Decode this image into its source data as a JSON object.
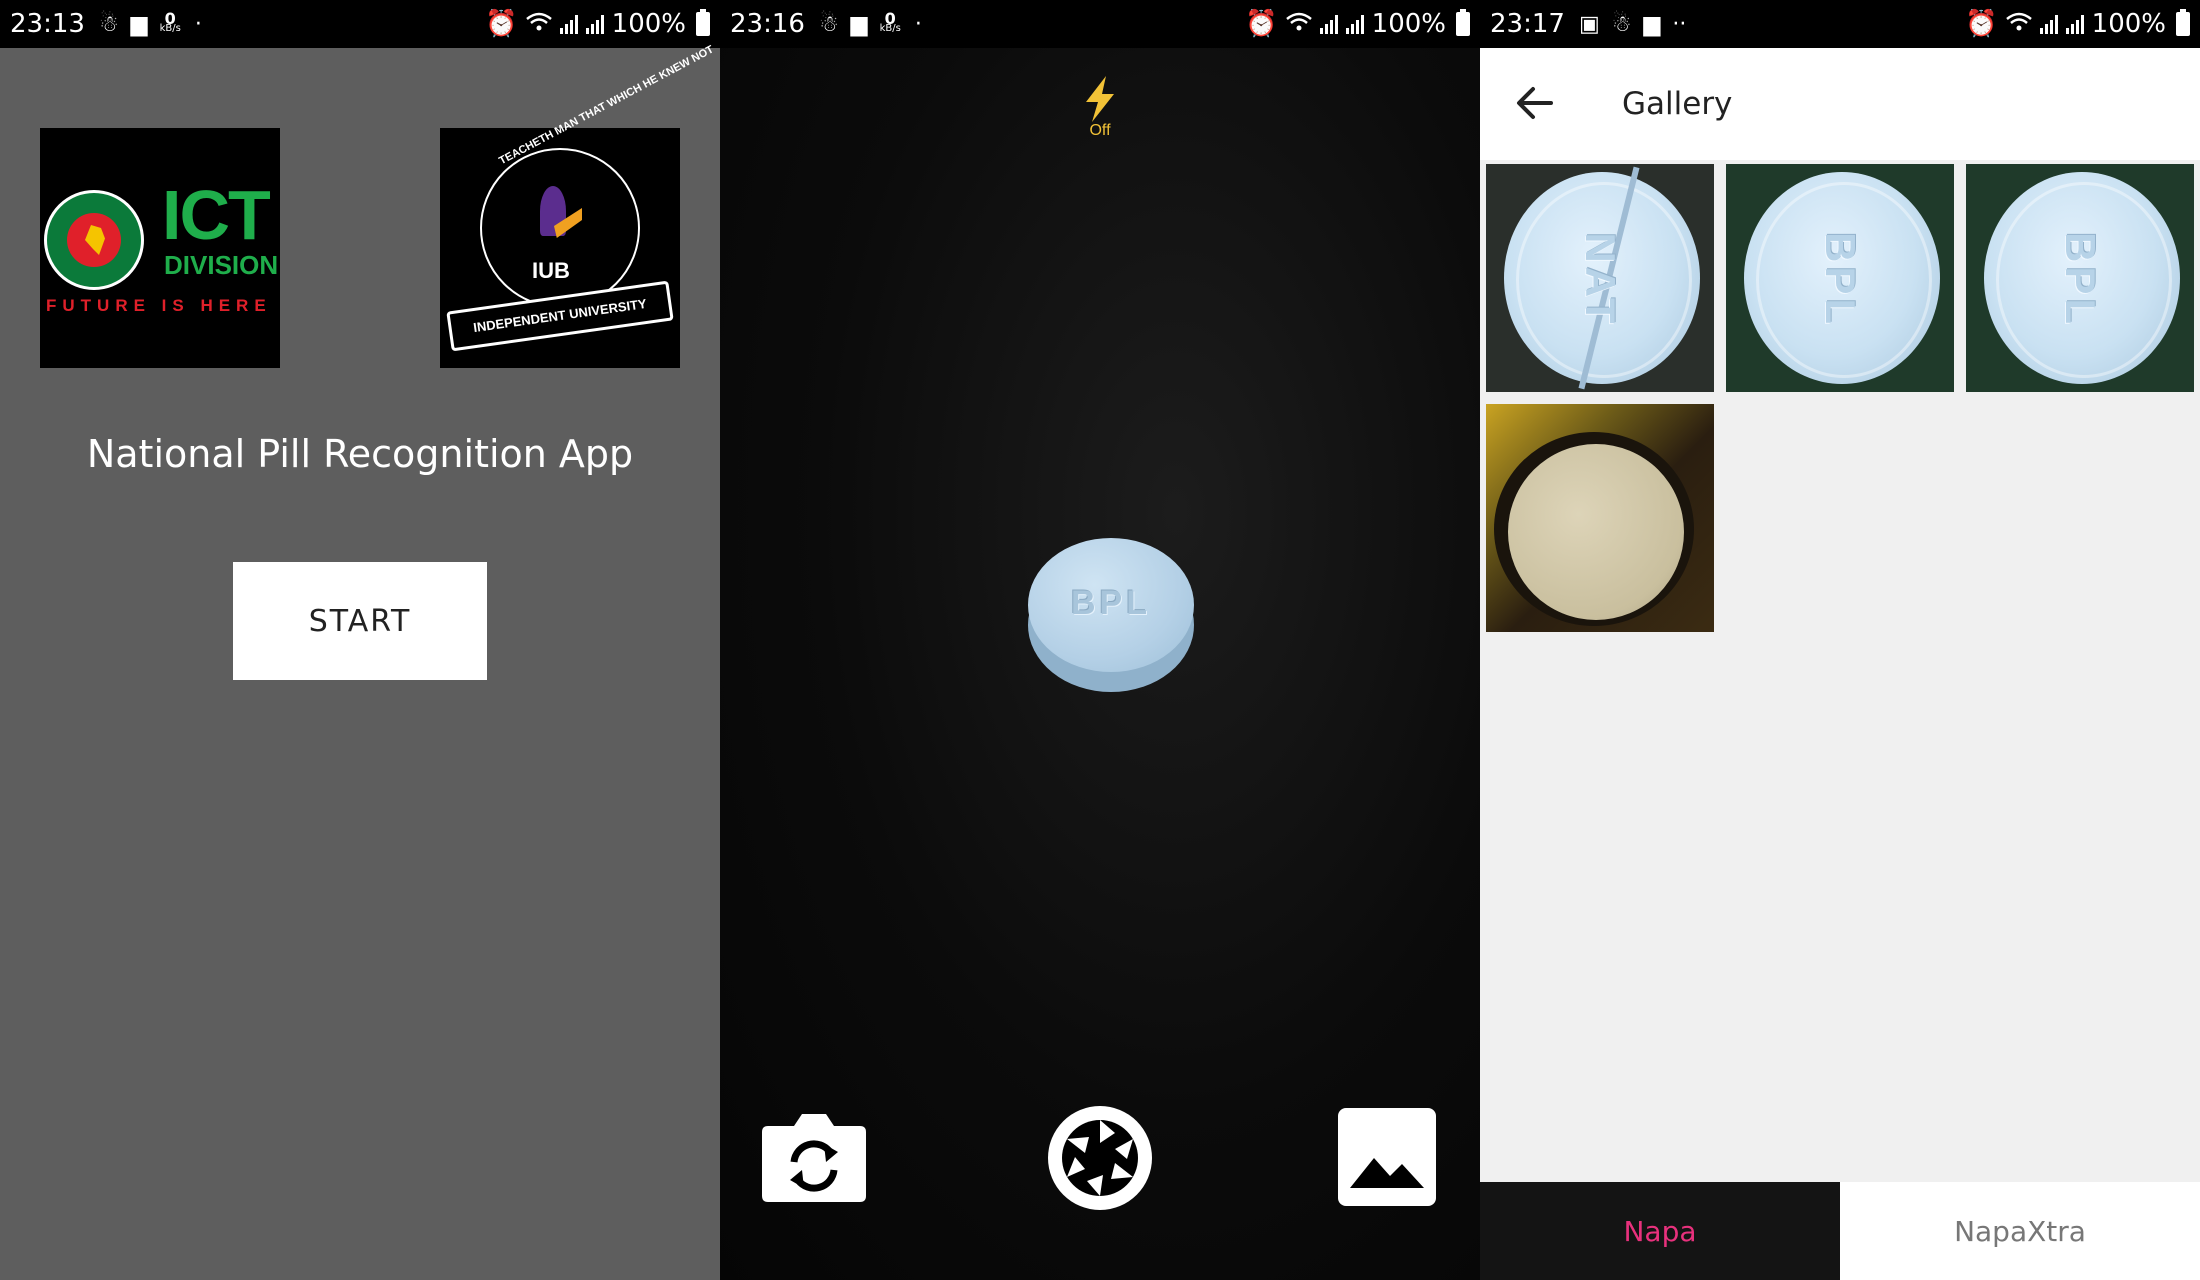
{
  "screen1": {
    "status": {
      "time": "23:13",
      "kbs_value": "0",
      "kbs_unit": "kB/s",
      "battery": "100%"
    },
    "ict_logo": {
      "title": "ICT",
      "subtitle": "DIVISION",
      "tagline": "FUTURE IS HERE"
    },
    "iub_logo": {
      "motto": "TEACHETH MAN THAT WHICH HE KNEW NOT",
      "abbr": "IUB",
      "banner": "INDEPENDENT UNIVERSITY"
    },
    "app_title": "National Pill Recognition App",
    "start_label": "START"
  },
  "screen2": {
    "status": {
      "time": "23:16",
      "kbs_value": "0",
      "kbs_unit": "kB/s",
      "battery": "100%"
    },
    "flash_label": "Off",
    "pill_imprint": "BPL"
  },
  "screen3": {
    "status": {
      "time": "23:17",
      "battery": "100%"
    },
    "title": "Gallery",
    "thumbs": [
      {
        "imprint": "NAT"
      },
      {
        "imprint": "BPL"
      },
      {
        "imprint": "BPL"
      }
    ],
    "tabs": [
      "Napa",
      "NapaXtra"
    ],
    "colors": {
      "active_tab_text": "#e8317d",
      "active_tab_bg": "#141414",
      "inactive_tab_text": "#777777"
    }
  },
  "icons": [
    "alarm-icon",
    "wifi-icon",
    "signal-icon",
    "battery-icon",
    "flash-icon",
    "switch-camera-icon",
    "shutter-icon",
    "gallery-icon",
    "back-arrow-icon"
  ]
}
